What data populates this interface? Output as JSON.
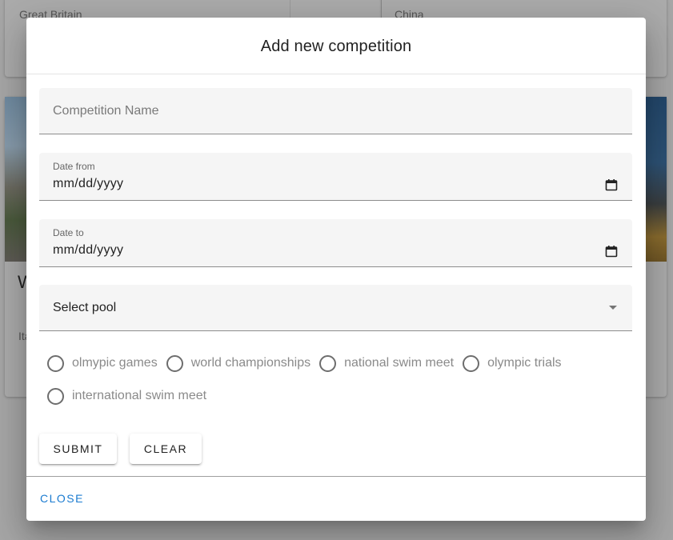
{
  "background": {
    "card_left_country": "Great Britain",
    "card_right_country": "China",
    "card_mid_title_fragment": "W",
    "card_mid_subtitle_fragment": "Ita"
  },
  "dialog": {
    "title": "Add new competition",
    "competition_name": {
      "placeholder": "Competition Name",
      "value": ""
    },
    "date_from": {
      "label": "Date from",
      "value": "mm/dd/yyyy",
      "icon": "calendar-icon"
    },
    "date_to": {
      "label": "Date to",
      "value": "mm/dd/yyyy",
      "icon": "calendar-icon"
    },
    "pool_select": {
      "value": "Select pool",
      "icon": "dropdown-arrow-icon"
    },
    "competition_types": [
      {
        "label": "olmypic games",
        "checked": false
      },
      {
        "label": "world championships",
        "checked": false
      },
      {
        "label": "national swim meet",
        "checked": false
      },
      {
        "label": "olympic trials",
        "checked": false
      },
      {
        "label": "international swim meet",
        "checked": false
      }
    ],
    "submit_label": "SUBMIT",
    "clear_label": "CLEAR",
    "close_label": "CLOSE"
  },
  "colors": {
    "accent": "#1a7bd0",
    "overlay": "#a6a6a6",
    "field_background": "#f5f5f5"
  }
}
